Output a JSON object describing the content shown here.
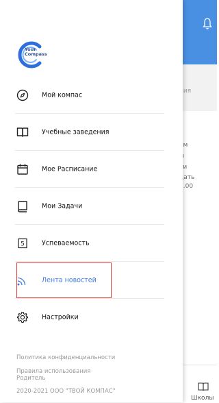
{
  "app": {
    "logo_line1": "Your",
    "logo_line2": "Compass"
  },
  "menu": {
    "items": [
      {
        "label": "Мой компас",
        "icon": "compass-icon"
      },
      {
        "label": "Учебные заведения",
        "icon": "book-icon"
      },
      {
        "label": "Мое Расписание",
        "icon": "calendar-icon"
      },
      {
        "label": "Мои Задачи",
        "icon": "task-book-icon"
      },
      {
        "label": "Успеваемость",
        "icon": "grade-icon"
      },
      {
        "label": "Лента новостей",
        "icon": "rss-feed-icon",
        "active": true
      },
      {
        "label": "Настройки",
        "icon": "gear-icon"
      }
    ]
  },
  "footer": {
    "privacy": "Политика конфиденциальности",
    "rules_line1": "Правила использования",
    "rules_line2": "Родитель",
    "copyright": "2020-2021 ООО \"ТВОЙ КОМПАС\""
  },
  "background": {
    "subbar_fragment": "ния",
    "content_lines": [
      "ем",
      "ы",
      "ки",
      "дать",
      "1.00"
    ],
    "content_tail": "у",
    "tab_label": "Школы"
  },
  "colors": {
    "header_blue": "#4a90e2",
    "active_blue": "#3d7be3",
    "highlight_red": "#e53935"
  }
}
